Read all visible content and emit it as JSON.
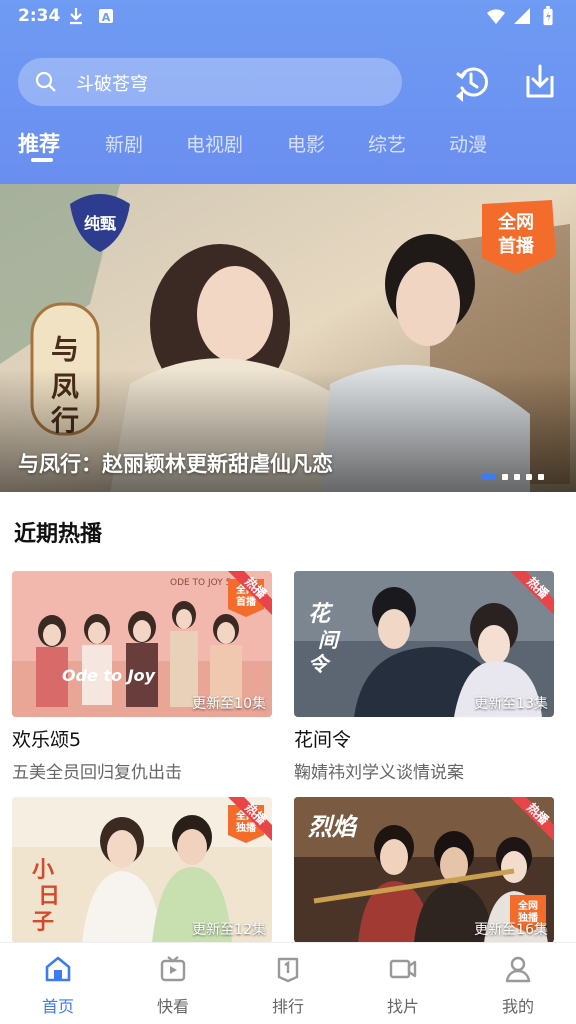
{
  "status": {
    "time": "2:34"
  },
  "search": {
    "placeholder": "斗破苍穹"
  },
  "tabs": [
    {
      "label": "推荐",
      "active": true
    },
    {
      "label": "新剧"
    },
    {
      "label": "电视剧"
    },
    {
      "label": "电影"
    },
    {
      "label": "综艺"
    },
    {
      "label": "动漫"
    }
  ],
  "banner": {
    "caption": "与凤行：赵丽颖林更新甜虐仙凡恋",
    "pages": 5,
    "active_page": 1
  },
  "section": {
    "title": "近期热播"
  },
  "cards": [
    {
      "title": "欢乐颂5",
      "subtitle": "五美全员回归复仇出击",
      "episodes": "更新至10集",
      "badge": "热播"
    },
    {
      "title": "花间令",
      "subtitle": "鞠婧祎刘学义谈情说案",
      "episodes": "更新至13集",
      "badge": "热播"
    },
    {
      "title": "",
      "subtitle": "",
      "episodes": "更新至12集",
      "badge": "热播"
    },
    {
      "title": "",
      "subtitle": "",
      "episodes": "更新至16集",
      "badge": "热播"
    }
  ],
  "bottom_nav": [
    {
      "label": "首页",
      "icon": "home-icon",
      "active": true
    },
    {
      "label": "快看",
      "icon": "play-video-icon"
    },
    {
      "label": "排行",
      "icon": "rank-icon"
    },
    {
      "label": "找片",
      "icon": "camera-icon"
    },
    {
      "label": "我的",
      "icon": "profile-icon"
    }
  ],
  "colors": {
    "header_gradient_top": "#6f9bf3",
    "accent": "#3e7bf0",
    "hot_badge": "#e8454a"
  }
}
